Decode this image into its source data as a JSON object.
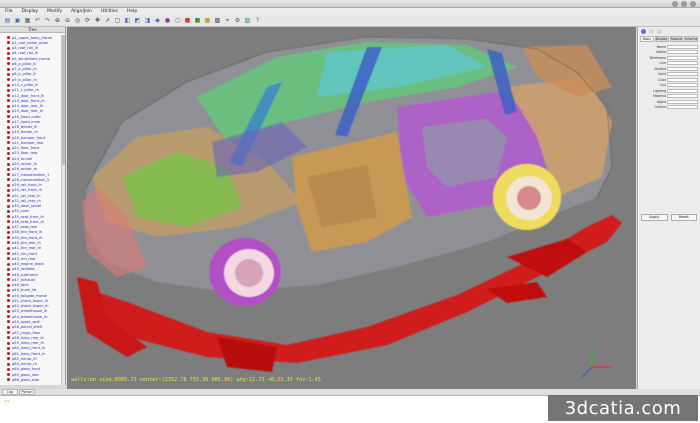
{
  "window": {
    "title": ""
  },
  "menu": [
    "File",
    "Display",
    "Modify",
    "Align/Join",
    "Utilities",
    "Help"
  ],
  "toolbar_icons": [
    {
      "name": "open-icon",
      "glyph": "▤",
      "color": "#3b6fb6"
    },
    {
      "name": "save-icon",
      "glyph": "▣",
      "color": "#3b6fb6"
    },
    {
      "name": "print-icon",
      "glyph": "▦",
      "color": "#555555"
    },
    {
      "name": "undo-icon",
      "glyph": "↶",
      "color": "#2a8a2a"
    },
    {
      "name": "redo-icon",
      "glyph": "↷",
      "color": "#2a8a2a"
    },
    {
      "name": "zoom-in-icon",
      "glyph": "⊕",
      "color": "#444444"
    },
    {
      "name": "zoom-out-icon",
      "glyph": "⊖",
      "color": "#444444"
    },
    {
      "name": "fit-icon",
      "glyph": "◎",
      "color": "#444444"
    },
    {
      "name": "rotate-icon",
      "glyph": "⟳",
      "color": "#444444"
    },
    {
      "name": "pan-icon",
      "glyph": "✥",
      "color": "#444444"
    },
    {
      "name": "select-icon",
      "glyph": "➚",
      "color": "#444444"
    },
    {
      "name": "box-select-icon",
      "glyph": "▢",
      "color": "#444444"
    },
    {
      "name": "view-front-icon",
      "glyph": "◧",
      "color": "#4a6ec0"
    },
    {
      "name": "view-top-icon",
      "glyph": "◩",
      "color": "#4a6ec0"
    },
    {
      "name": "view-side-icon",
      "glyph": "◨",
      "color": "#4a6ec0"
    },
    {
      "name": "view-iso-icon",
      "glyph": "◆",
      "color": "#4a6ec0"
    },
    {
      "name": "shade-icon",
      "glyph": "●",
      "color": "#8040a0"
    },
    {
      "name": "wireframe-icon",
      "glyph": "○",
      "color": "#8040a0"
    },
    {
      "name": "color-icon",
      "glyph": "■",
      "color": "#d43c2c"
    },
    {
      "name": "palette-icon",
      "glyph": "■",
      "color": "#2f9a3c"
    },
    {
      "name": "layers-icon",
      "glyph": "■",
      "color": "#c9a42a"
    },
    {
      "name": "mesh-icon",
      "glyph": "▩",
      "color": "#555555"
    },
    {
      "name": "measure-icon",
      "glyph": "⌖",
      "color": "#555555"
    },
    {
      "name": "settings-icon",
      "glyph": "⚙",
      "color": "#555555"
    },
    {
      "name": "image-icon",
      "glyph": "▨",
      "color": "#3b8a3b"
    },
    {
      "name": "help-icon",
      "glyph": "?",
      "color": "#3b6fb6"
    }
  ],
  "model_tree": {
    "header": "Tree",
    "items": [
      "p1_upper_body_frame",
      "p2_roof_panel_outer",
      "p3_roof_rail_lh",
      "p4_roof_rail_rh",
      "p5_windshield_frame",
      "p6_a_pillar_lh",
      "p7_a_pillar_rh",
      "p8_b_pillar_lh",
      "p9_b_pillar_rh",
      "p10_c_pillar_lh",
      "p11_c_pillar_rh",
      "p12_door_front_lh",
      "p13_door_front_rh",
      "p14_door_rear_lh",
      "p15_door_rear_rh",
      "p16_hood_outer",
      "p17_hood_inner",
      "p18_fender_lh",
      "p19_fender_rh",
      "p20_bumper_front",
      "p21_bumper_rear",
      "p22_floor_front",
      "p23_floor_rear",
      "p24_tunnel",
      "p25_rocker_lh",
      "p26_rocker_rh",
      "p27_crossmember_1",
      "p28_crossmember_2",
      "p29_rail_front_lh",
      "p30_rail_front_rh",
      "p31_rail_rear_lh",
      "p32_rail_rear_rh",
      "p33_dash_panel",
      "p34_cowl",
      "p35_seat_front_lh",
      "p36_seat_front_rh",
      "p37_seat_rear",
      "p38_tire_front_lh",
      "p39_tire_front_rh",
      "p40_tire_rear_lh",
      "p41_tire_rear_rh",
      "p42_rim_front",
      "p43_rim_rear",
      "p44_engine_block",
      "p45_radiator",
      "p46_subframe",
      "p47_exhaust",
      "p48_tank",
      "p49_trunk_lid",
      "p50_tailgate_frame",
      "p51_shock_tower_lh",
      "p52_shock_tower_rh",
      "p53_wheelhouse_lh",
      "p54_wheelhouse_rh",
      "p55_spare_well",
      "p56_parcel_shelf",
      "p57_cargo_floor",
      "p58_lamp_rear_lh",
      "p59_lamp_rear_rh",
      "p60_lamp_front_lh",
      "p61_lamp_front_rh",
      "p62_mirror_lh",
      "p63_mirror_rh",
      "p64_glass_front",
      "p65_glass_rear",
      "p66_glass_side"
    ]
  },
  "viewport": {
    "status": "walls:on  size:8985.73  center:(2352.78  755.96  885.96)  ang:12.73  +6:23.37  fov:1.45"
  },
  "properties": {
    "tabs": [
      "Basic",
      "Display",
      "Advanced",
      "Information"
    ],
    "rows": [
      {
        "label": "Name",
        "value": ""
      },
      {
        "label": "Visible",
        "value": ""
      },
      {
        "label": "Wireframe",
        "value": ""
      },
      {
        "label": "Line",
        "value": ""
      },
      {
        "label": "Shaded",
        "value": ""
      },
      {
        "label": "Solid",
        "value": ""
      },
      {
        "label": "Color",
        "value": ""
      },
      {
        "label": "Cull",
        "value": ""
      },
      {
        "label": "Lighting",
        "value": ""
      },
      {
        "label": "Material",
        "value": ""
      },
      {
        "label": "Alpha",
        "value": ""
      },
      {
        "label": "Outline",
        "value": ""
      }
    ],
    "apply_label": "Apply",
    "reset_label": "Reset",
    "icon_colors": [
      "#5a6fd0",
      "#d6d6d6",
      "#d6d6d6"
    ]
  },
  "console": {
    "tabs": [
      "Log",
      "Python"
    ],
    "line": ">>"
  },
  "watermark": "3dcatia.com",
  "colors": {
    "viewport_bg": "#7d7d7d",
    "status_text": "#e8e64a",
    "tree_text": "#2b2bb5",
    "tree_bullet": "#c8141e"
  }
}
